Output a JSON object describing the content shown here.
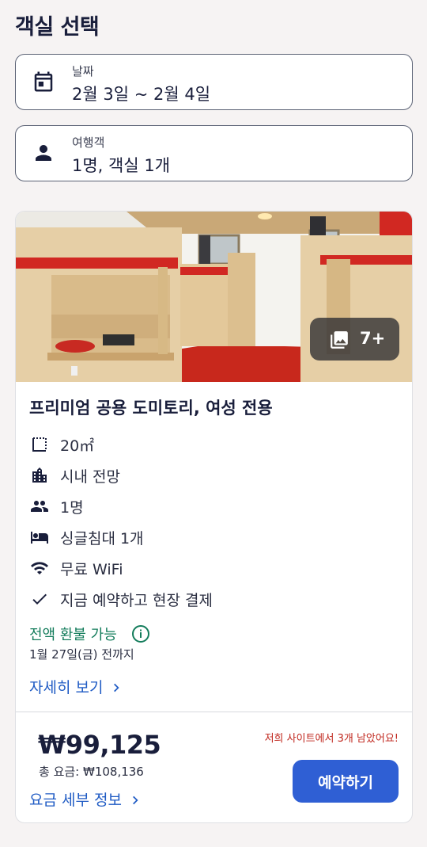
{
  "page": {
    "title": "객실 선택"
  },
  "search": {
    "dates": {
      "label": "날짜",
      "value": "2월 3일 ~ 2월 4일",
      "icon": "calendar-icon"
    },
    "travelers": {
      "label": "여행객",
      "value": "1명, 객실 1개",
      "icon": "person-icon"
    }
  },
  "room": {
    "gallery_count": "7+",
    "name": "프리미엄 공용 도미토리, 여성 전용",
    "amenities": [
      {
        "icon": "room-size-icon",
        "text": "20㎡"
      },
      {
        "icon": "city-view-icon",
        "text": "시내 전망"
      },
      {
        "icon": "guests-icon",
        "text": "1명"
      },
      {
        "icon": "bed-icon",
        "text": "싱글침대 1개"
      },
      {
        "icon": "wifi-icon",
        "text": "무료 WiFi"
      },
      {
        "icon": "check-icon",
        "text": "지금 예약하고 현장 결제"
      }
    ],
    "refund": {
      "label": "전액 환불 가능",
      "deadline": "1월 27일(금) 전까지"
    },
    "details_link": "자세히 보기",
    "price": "₩99,125",
    "total": "총 요금: ₩108,136",
    "price_details_link": "요금 세부 정보",
    "scarcity": "저희 사이트에서 3개 남았어요!",
    "book_label": "예약하기"
  },
  "colors": {
    "primary": "#2f5fd4",
    "link": "#1f5bc4",
    "refund_green": "#137c5b",
    "alert_red": "#c0281f",
    "text": "#191e3b"
  }
}
